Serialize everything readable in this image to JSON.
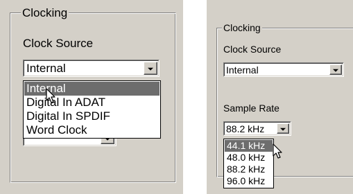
{
  "left_panel": {
    "group_title": "Clocking",
    "clock_source_label": "Clock Source",
    "clock_source_value": "Internal",
    "clock_source_options": [
      "Internal",
      "Digital In ADAT",
      "Digital In SPDIF",
      "Word Clock"
    ],
    "highlighted_option": "Internal"
  },
  "right_panel": {
    "group_title": "Clocking",
    "clock_source_label": "Clock Source",
    "clock_source_value": "Internal",
    "sample_rate_label": "Sample Rate",
    "sample_rate_value": "88.2 kHz",
    "sample_rate_options": [
      "44.1 kHz",
      "48.0 kHz",
      "88.2 kHz",
      "96.0 kHz"
    ],
    "highlighted_option": "44.1 kHz"
  },
  "icons": {
    "dropdown_arrow": "chevron-down-icon",
    "cursor": "mouse-pointer-icon"
  },
  "colors": {
    "dialog_background": "#d4d0c8",
    "selection_highlight": "#6d6d6d",
    "list_background": "#ffffff"
  }
}
